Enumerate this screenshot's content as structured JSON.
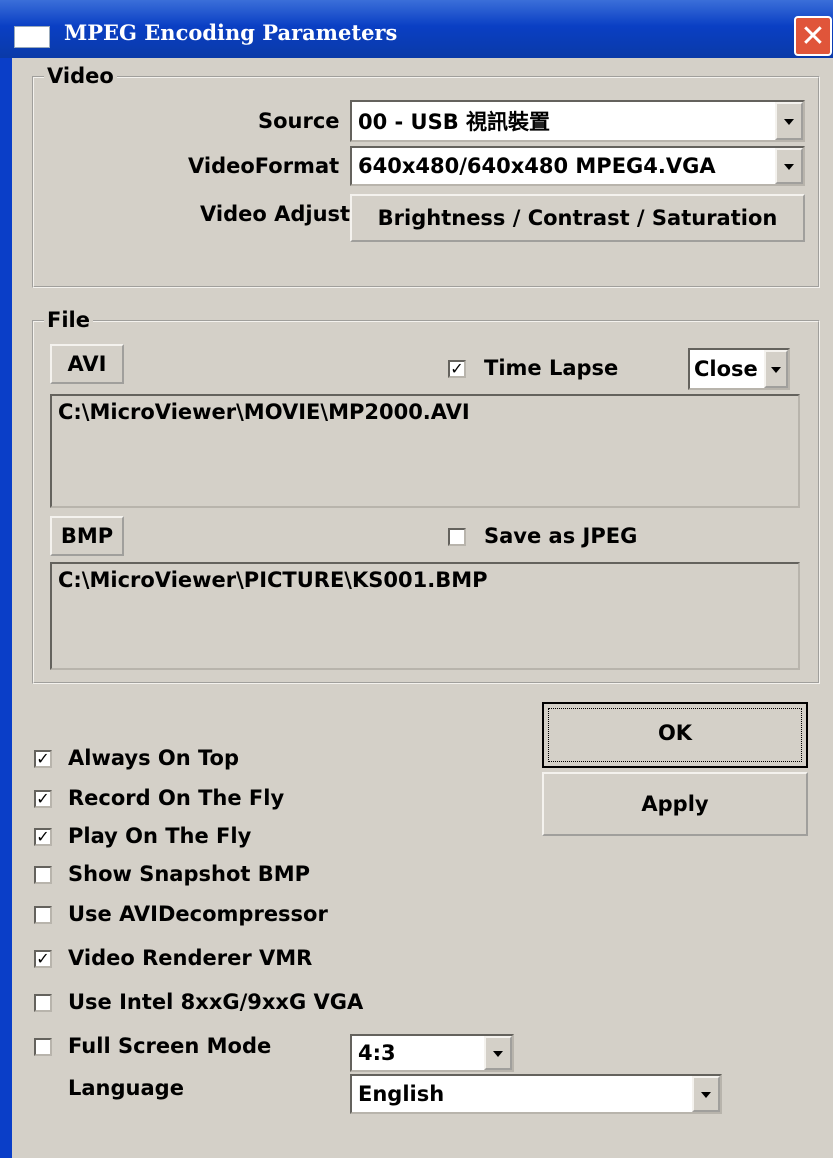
{
  "window": {
    "title": "MPEG Encoding Parameters"
  },
  "video": {
    "group_label": "Video",
    "source_label": "Source",
    "source_value": "00 - USB 視訊裝置",
    "format_label": "VideoFormat",
    "format_value": "640x480/640x480 MPEG4.VGA",
    "adjust_label": "Video Adjust",
    "adjust_button": "Brightness / Contrast / Saturation"
  },
  "file": {
    "group_label": "File",
    "avi_button": "AVI",
    "time_lapse_label": "Time Lapse",
    "time_lapse_checked": true,
    "time_lapse_value": "Close",
    "avi_path": "C:\\MicroViewer\\MOVIE\\MP2000.AVI",
    "bmp_button": "BMP",
    "save_jpeg_label": "Save as JPEG",
    "save_jpeg_checked": false,
    "bmp_path": "C:\\MicroViewer\\PICTURE\\KS001.BMP"
  },
  "buttons": {
    "ok": "OK",
    "apply": "Apply"
  },
  "options": [
    {
      "label": "Always On Top",
      "checked": true
    },
    {
      "label": "Record On The Fly",
      "checked": true
    },
    {
      "label": "Play On The Fly",
      "checked": true
    },
    {
      "label": "Show Snapshot BMP",
      "checked": false
    },
    {
      "label": "Use AVIDecompressor",
      "checked": false
    },
    {
      "label": "Video Renderer VMR",
      "checked": true
    },
    {
      "label": "Use Intel 8xxG/9xxG VGA",
      "checked": false
    },
    {
      "label": "Full Screen Mode",
      "checked": false
    }
  ],
  "fullscreen_ratio": "4:3",
  "language": {
    "label": "Language",
    "value": "English"
  }
}
